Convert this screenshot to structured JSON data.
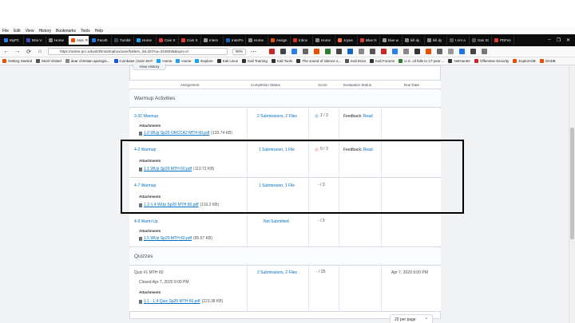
{
  "menu": [
    "File",
    "Edit",
    "View",
    "History",
    "Bookmarks",
    "Tools",
    "Help"
  ],
  "tabs": [
    {
      "label": "MyPC",
      "color": "#2b7de9",
      "active": false
    },
    {
      "label": "Bria V.",
      "color": "#3f51b5",
      "active": false
    },
    {
      "label": "Home",
      "color": "#888",
      "active": false
    },
    {
      "label": "Assi",
      "color": "#e65100",
      "active": true
    },
    {
      "label": "Faceb",
      "color": "#1877f2",
      "active": false
    },
    {
      "label": "Tumblr",
      "color": "#35465c",
      "active": false
    },
    {
      "label": "Home",
      "color": "#1da1f2",
      "active": false
    },
    {
      "label": "Cain S",
      "color": "#e53935",
      "active": false
    },
    {
      "label": "Cain S",
      "color": "#e53935",
      "active": false
    },
    {
      "label": "Interv",
      "color": "#999",
      "active": false
    },
    {
      "label": "InterPo",
      "color": "#1565c0",
      "active": false
    },
    {
      "label": "Home",
      "color": "#888",
      "active": false
    },
    {
      "label": "Assign",
      "color": "#e65100",
      "active": false
    },
    {
      "label": "Inbox",
      "color": "#d93025",
      "active": false
    },
    {
      "label": "Home",
      "color": "#888",
      "active": false
    },
    {
      "label": "Joyas",
      "color": "#ff7043",
      "active": false
    },
    {
      "label": "Blue N",
      "color": "#e53935",
      "active": false
    },
    {
      "label": "blue w",
      "color": "#999",
      "active": false
    },
    {
      "label": "kill dy",
      "color": "#888",
      "active": false
    },
    {
      "label": "kill dy",
      "color": "#888",
      "active": false
    },
    {
      "label": "I Am a",
      "color": "#555",
      "active": false
    },
    {
      "label": "Gas St",
      "color": "#555",
      "active": false
    },
    {
      "label": "PDFes",
      "color": "#e53935",
      "active": false
    }
  ],
  "nav": {
    "url": "https://online.pcc.edu/d2l/lms/dropbox/user/folders_list.d2l?ou=3249336&isprv=0",
    "zoom": "90%",
    "dots": "⋯",
    "back_icon": "←",
    "forward_icon": "→",
    "reload_icon": "⟳",
    "home_icon": "⌂"
  },
  "bookmarks": [
    {
      "label": "Getting Started",
      "color": "#e65100"
    },
    {
      "label": "Most Visited",
      "color": "#555"
    },
    {
      "label": "dear christian apologis...",
      "color": "#888"
    },
    {
      "label": "Coinbase | Earn BAT",
      "color": "#1652f0"
    },
    {
      "label": "Home",
      "color": "#1da1f2"
    },
    {
      "label": "Home",
      "color": "#1da1f2"
    },
    {
      "label": "Explore",
      "color": "#1da1f2"
    },
    {
      "label": "Kali Linux",
      "color": "#333"
    },
    {
      "label": "Kali Training",
      "color": "#333"
    },
    {
      "label": "Kali Tools",
      "color": "#333"
    },
    {
      "label": "The sound of silence o...",
      "color": "#333"
    },
    {
      "label": "Kali Docs",
      "color": "#555"
    },
    {
      "label": "Kali Forums",
      "color": "#333"
    },
    {
      "label": "U.S. oil falls to 17-year ...",
      "color": "#2e7d32"
    },
    {
      "label": "NetHunter",
      "color": "#333"
    },
    {
      "label": "Offensive Security",
      "color": "#c62828"
    },
    {
      "label": "Exploit-DB",
      "color": "#e65100"
    },
    {
      "label": "GHDB",
      "color": "#e65100"
    }
  ],
  "view_history": "View History",
  "headers": {
    "assignment": "Assignment",
    "completion": "Completion Status",
    "score": "Score",
    "evaluation": "Evaluation Status",
    "due": "Due Date"
  },
  "sections": {
    "warmup": "Warmup Activities",
    "quizzes": "Quizzes"
  },
  "rows": [
    {
      "name": "3-31 Warmup",
      "completion": "2 Submissions, 2 Files",
      "score": "2 / 2",
      "dot": "#c8d8e8",
      "feedback_label": "Feedback:",
      "feedback_link": "Read",
      "attachments": "Attachments",
      "file": "1.0 WUp Sp20 ORCCA2 MTH 60.pdf",
      "size": "(133.74 KB)",
      "due": ""
    },
    {
      "name": "4-2 Warmup",
      "completion": "1 Submission, 1 File",
      "score": "0 / 3",
      "dot": "#f6d3d3",
      "feedback_label": "Feedback:",
      "feedback_link": "Read",
      "attachments": "Attachments",
      "file": "1.1 WUp Sp20 MTH 60.pdf",
      "size": "(113.72 KB)",
      "due": ""
    },
    {
      "name": "4-7 Warmup",
      "completion": "1 Submission, 1 File",
      "score": "- / 3",
      "dot": "",
      "feedback_label": "",
      "feedback_link": "",
      "attachments": "Attachments",
      "file": "1.2-1.4 WUp Sp20 MTH 60.pdf",
      "size": "(116.3 KB)",
      "due": ""
    },
    {
      "name": "4-9 Warm Up",
      "completion": "Not Submitted",
      "score": "- / 3",
      "dot": "",
      "feedback_label": "",
      "feedback_link": "",
      "attachments": "Attachments",
      "file": "1.5 WUp Sp20 MTH 60.pdf",
      "size": "(85.67 KB)",
      "due": ""
    }
  ],
  "quiz": {
    "name": "Quiz #1 MTH 60",
    "completion": "2 Submissions, 2 Files",
    "score": "- / 25",
    "due": "Apr 7, 2020 9:00 PM",
    "closed": "Closed Apr 7, 2020 9:00 PM",
    "attachments": "Attachments",
    "file": "1.1 - 1.4 Quiz Sp20 MTH 60.pdf",
    "size": "(223.38 KB)"
  },
  "pager": "20 per page",
  "pager_icon": "⌄"
}
